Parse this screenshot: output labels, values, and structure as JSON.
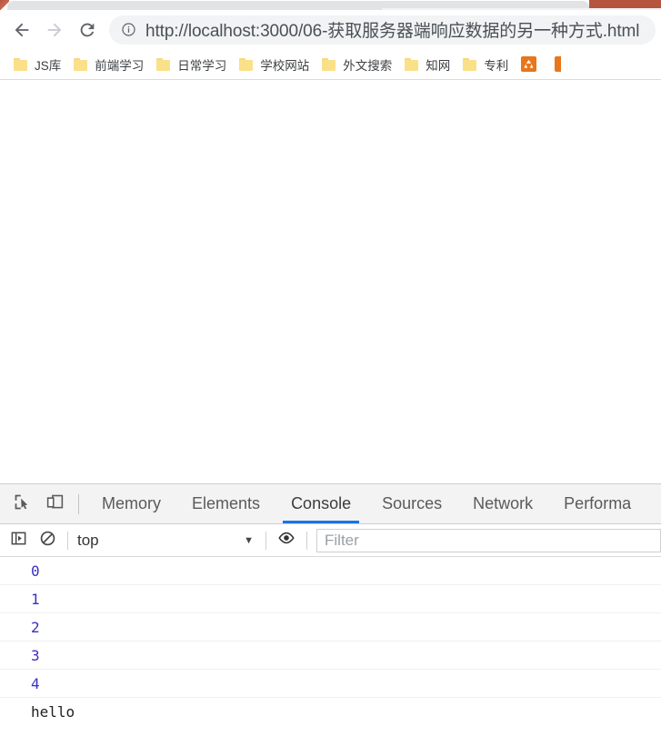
{
  "browser": {
    "nav": {
      "back_label": "Back",
      "forward_label": "Forward",
      "reload_label": "Reload"
    },
    "omnibox": {
      "url": "http://localhost:3000/06-获取服务器端响应数据的另一种方式.html",
      "security_icon": "info-circle-icon"
    },
    "bookmarks": [
      {
        "label": "JS库",
        "icon": "folder-icon"
      },
      {
        "label": "前端学习",
        "icon": "folder-icon"
      },
      {
        "label": "日常学习",
        "icon": "folder-icon"
      },
      {
        "label": "学校网站",
        "icon": "folder-icon"
      },
      {
        "label": "外文搜索",
        "icon": "folder-icon"
      },
      {
        "label": "知网",
        "icon": "folder-icon"
      },
      {
        "label": "专利",
        "icon": "folder-icon"
      }
    ]
  },
  "devtools": {
    "inspect_icon": "inspect-element-icon",
    "device_icon": "device-toolbar-icon",
    "tabs": [
      {
        "label": "Memory",
        "active": false
      },
      {
        "label": "Elements",
        "active": false
      },
      {
        "label": "Console",
        "active": true
      },
      {
        "label": "Sources",
        "active": false
      },
      {
        "label": "Network",
        "active": false
      },
      {
        "label": "Performa",
        "active": false
      }
    ],
    "active_tab": "Console",
    "accent_color": "#1a73e8",
    "console_toolbar": {
      "sidebar_icon": "console-sidebar-icon",
      "clear_icon": "clear-console-icon",
      "context": "top",
      "context_caret": "▼",
      "eye_icon": "live-expression-eye-icon",
      "filter_placeholder": "Filter",
      "filter_value": ""
    },
    "console_messages": [
      {
        "text": "0",
        "kind": "num"
      },
      {
        "text": "1",
        "kind": "num"
      },
      {
        "text": "2",
        "kind": "num"
      },
      {
        "text": "3",
        "kind": "num"
      },
      {
        "text": "4",
        "kind": "num"
      },
      {
        "text": "hello",
        "kind": "str"
      }
    ],
    "colors": {
      "number": "#3b2ec4",
      "string": "#202124"
    }
  }
}
